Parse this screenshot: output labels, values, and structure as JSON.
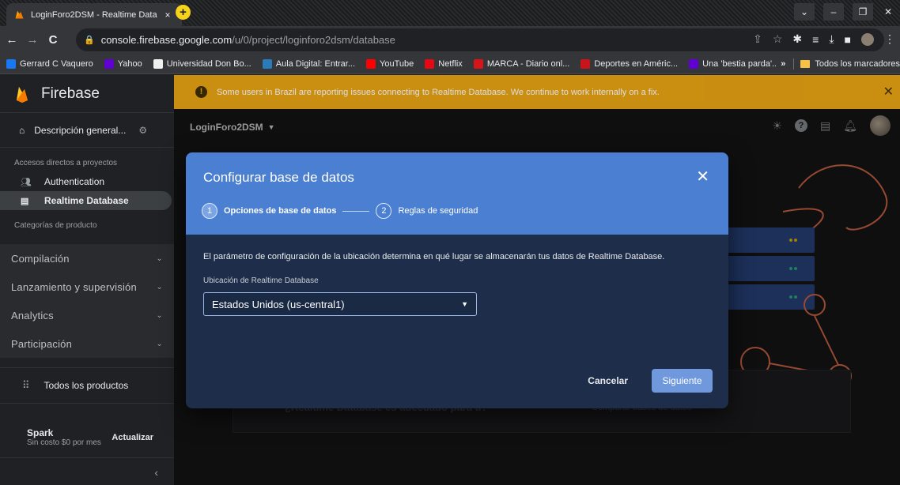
{
  "browser": {
    "tab_title": "LoginForo2DSM - Realtime Data",
    "tab_close": "×",
    "new_tab": "+",
    "url_host": "console.firebase.google.com",
    "url_path": "/u/0/project/loginforo2dsm/database",
    "bookmarks": [
      {
        "label": "Gerrard C Vaquero",
        "icon": "facebook-icon",
        "color": "#1877f2"
      },
      {
        "label": "Yahoo",
        "icon": "yahoo-icon",
        "color": "#6001d2"
      },
      {
        "label": "Universidad Don Bo...",
        "icon": "udb-icon",
        "color": "#f0f0f0"
      },
      {
        "label": "Aula Digital: Entrar...",
        "icon": "aula-icon",
        "color": "#2b7bb9"
      },
      {
        "label": "YouTube",
        "icon": "youtube-icon",
        "color": "#ff0000"
      },
      {
        "label": "Netflix",
        "icon": "netflix-icon",
        "color": "#e50914"
      },
      {
        "label": "MARCA - Diario onl...",
        "icon": "marca-icon",
        "color": "#d7141a"
      },
      {
        "label": "Deportes en Améric...",
        "icon": "as-icon",
        "color": "#c9141a"
      },
      {
        "label": "Una 'bestia parda'...",
        "icon": "yahoo-icon",
        "color": "#6001d2"
      }
    ],
    "bookmarks_more": "»",
    "all_bookmarks": "Todos los marcadores"
  },
  "sidebar": {
    "brand": "Firebase",
    "overview": "Descripción general...",
    "shortcuts_heading": "Accesos directos a proyectos",
    "shortcuts": [
      {
        "label": "Authentication",
        "icon": "users-icon"
      },
      {
        "label": "Realtime Database",
        "icon": "database-icon"
      }
    ],
    "categories_heading": "Categorías de producto",
    "categories": [
      {
        "label": "Compilación"
      },
      {
        "label": "Lanzamiento y supervisión"
      },
      {
        "label": "Analytics"
      },
      {
        "label": "Participación"
      }
    ],
    "all_products": "Todos los productos",
    "plan_name": "Spark",
    "plan_sub": "Sin costo $0 por mes",
    "upgrade": "Actualizar"
  },
  "banner": {
    "text": "Some users in Brazil are reporting issues connecting to Realtime Database. We continue to work internally on a fix.",
    "color": "#e8a10e"
  },
  "main": {
    "project": "LoginForo2DSM"
  },
  "dialog": {
    "title": "Configurar base de datos",
    "steps": [
      {
        "num": "1",
        "label": "Opciones de base de datos"
      },
      {
        "num": "2",
        "label": "Reglas de seguridad"
      }
    ],
    "description": "El parámetro de configuración de la ubicación determina en qué lugar se almacenarán tus datos de Realtime Database.",
    "field_label": "Ubicación de Realtime Database",
    "field_value": "Estados Unidos (us-central1)",
    "cancel": "Cancelar",
    "next": "Siguiente",
    "accent": "#4a7fd1"
  },
  "background": {
    "card_question": "¿Realtime Database es adecuado para ti?",
    "card_link": "Comparar bases de datos"
  }
}
